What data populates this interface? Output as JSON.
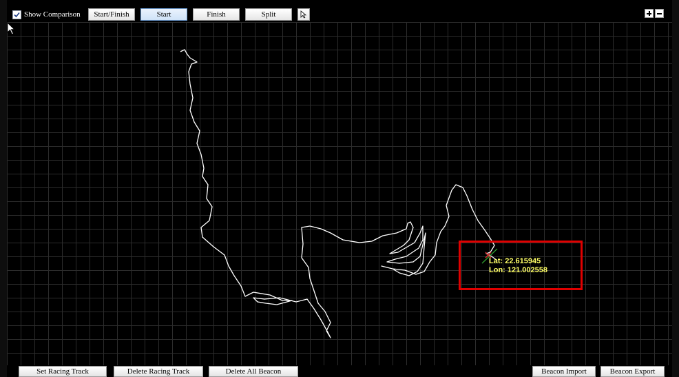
{
  "toolbar": {
    "show_comparison_label": "Show Comparison",
    "show_comparison_checked": true,
    "buttons": [
      "Start/Finish",
      "Start",
      "Finish",
      "Split"
    ],
    "active_button": "Start",
    "pointer_icon": "arrow-pointer-icon",
    "zoom_in_icon": "plus-icon",
    "zoom_out_icon": "minus-icon"
  },
  "map": {
    "lat_text": "Lat: 22.615945",
    "lon_text": "Lon: 121.002558",
    "track_color": "#ffffff",
    "grid_color": "#2c2c2c",
    "highlight_color": "#e00000",
    "coord_text_color": "#ffff66"
  },
  "bottom": {
    "buttons": [
      "Set Racing Track",
      "Delete Racing Track",
      "Delete All Beacon",
      "Beacon Import",
      "Beacon Export"
    ]
  }
}
